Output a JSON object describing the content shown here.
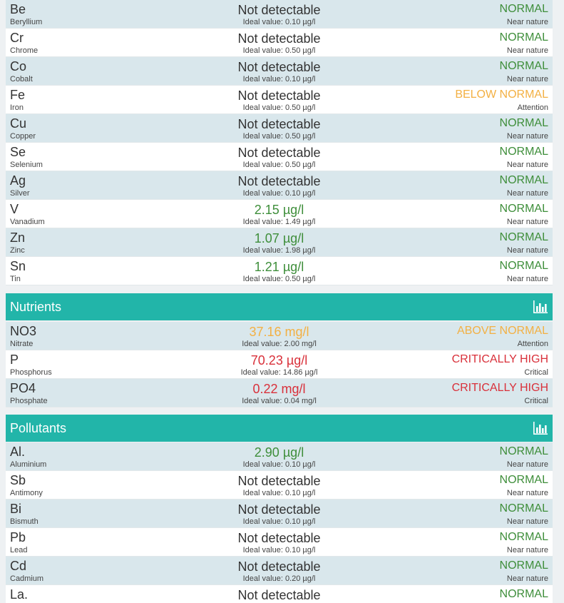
{
  "colors": {
    "normal": "#3e8e3a",
    "attention": "#f3b043",
    "critical": "#d9303a",
    "header_bg": "#22b5a9",
    "row_alt": "#d9e7ec"
  },
  "top_rows": [
    {
      "symbol": "Be",
      "name": "Beryllium",
      "value": "Not detectable",
      "ideal": "Ideal value: 0.10 µg/l",
      "status": "NORMAL",
      "note": "Near nature"
    },
    {
      "symbol": "Cr",
      "name": "Chrome",
      "value": "Not detectable",
      "ideal": "Ideal value: 0.50 µg/l",
      "status": "NORMAL",
      "note": "Near nature"
    },
    {
      "symbol": "Co",
      "name": "Cobalt",
      "value": "Not detectable",
      "ideal": "Ideal value: 0.10 µg/l",
      "status": "NORMAL",
      "note": "Near nature"
    },
    {
      "symbol": "Fe",
      "name": "Iron",
      "value": "Not detectable",
      "ideal": "Ideal value: 0.50 µg/l",
      "status": "BELOW NORMAL",
      "note": "Attention"
    },
    {
      "symbol": "Cu",
      "name": "Copper",
      "value": "Not detectable",
      "ideal": "Ideal value: 0.50 µg/l",
      "status": "NORMAL",
      "note": "Near nature"
    },
    {
      "symbol": "Se",
      "name": "Selenium",
      "value": "Not detectable",
      "ideal": "Ideal value: 0.50 µg/l",
      "status": "NORMAL",
      "note": "Near nature"
    },
    {
      "symbol": "Ag",
      "name": "Silver",
      "value": "Not detectable",
      "ideal": "Ideal value: 0.10 µg/l",
      "status": "NORMAL",
      "note": "Near nature"
    },
    {
      "symbol": "V",
      "name": "Vanadium",
      "value": "2.15 µg/l",
      "ideal": "Ideal value: 1.49 µg/l",
      "status": "NORMAL",
      "note": "Near nature"
    },
    {
      "symbol": "Zn",
      "name": "Zinc",
      "value": "1.07 µg/l",
      "ideal": "Ideal value: 1.98 µg/l",
      "status": "NORMAL",
      "note": "Near nature"
    },
    {
      "symbol": "Sn",
      "name": "Tin",
      "value": "1.21 µg/l",
      "ideal": "Ideal value: 0.50 µg/l",
      "status": "NORMAL",
      "note": "Near nature"
    }
  ],
  "nutrients": {
    "title": "Nutrients",
    "chart_icon": "bar-chart-icon",
    "rows": [
      {
        "symbol": "NO3",
        "name": "Nitrate",
        "value": "37.16 mg/l",
        "ideal": "Ideal value: 2.00 mg/l",
        "status": "ABOVE NORMAL",
        "note": "Attention"
      },
      {
        "symbol": "P",
        "name": "Phosphorus",
        "value": "70.23 µg/l",
        "ideal": "Ideal value: 14.86 µg/l",
        "status": "CRITICALLY HIGH",
        "note": "Critical"
      },
      {
        "symbol": "PO4",
        "name": "Phosphate",
        "value": "0.22 mg/l",
        "ideal": "Ideal value: 0.04 mg/l",
        "status": "CRITICALLY HIGH",
        "note": "Critical"
      }
    ]
  },
  "pollutants": {
    "title": "Pollutants",
    "chart_icon": "bar-chart-icon",
    "rows": [
      {
        "symbol": "Al.",
        "name": "Aluminium",
        "value": "2.90 µg/l",
        "ideal": "Ideal value: 0.10 µg/l",
        "status": "NORMAL",
        "note": "Near nature"
      },
      {
        "symbol": "Sb",
        "name": "Antimony",
        "value": "Not detectable",
        "ideal": "Ideal value: 0.10 µg/l",
        "status": "NORMAL",
        "note": "Near nature"
      },
      {
        "symbol": "Bi",
        "name": "Bismuth",
        "value": "Not detectable",
        "ideal": "Ideal value: 0.10 µg/l",
        "status": "NORMAL",
        "note": "Near nature"
      },
      {
        "symbol": "Pb",
        "name": "Lead",
        "value": "Not detectable",
        "ideal": "Ideal value: 0.10 µg/l",
        "status": "NORMAL",
        "note": "Near nature"
      },
      {
        "symbol": "Cd",
        "name": "Cadmium",
        "value": "Not detectable",
        "ideal": "Ideal value: 0.20 µg/l",
        "status": "NORMAL",
        "note": "Near nature"
      },
      {
        "symbol": "La.",
        "name": "",
        "value": "Not detectable",
        "ideal": "",
        "status": "NORMAL",
        "note": ""
      }
    ]
  }
}
